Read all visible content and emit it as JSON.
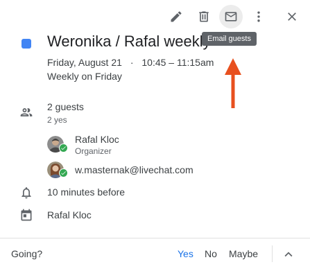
{
  "toolbar": {
    "tooltip": "Email guests",
    "icons": [
      "edit-icon",
      "delete-icon",
      "email-icon",
      "more-vert-icon",
      "close-icon"
    ]
  },
  "event": {
    "title": "Weronika / Rafal weekly",
    "date": "Friday, August 21",
    "separator": "·",
    "time": "10:45 – 11:15am",
    "recurrence": "Weekly on Friday",
    "color": "#4285f4"
  },
  "guests": {
    "count_label": "2 guests",
    "yes_label": "2 yes",
    "list": [
      {
        "name": "Rafal Kloc",
        "role": "Organizer"
      },
      {
        "name": "w.masternak@livechat.com",
        "role": ""
      }
    ]
  },
  "notification": {
    "label": "10 minutes before"
  },
  "calendar": {
    "owner": "Rafal Kloc"
  },
  "rsvp": {
    "question": "Going?",
    "options": [
      "Yes",
      "No",
      "Maybe"
    ],
    "selected": "Yes"
  },
  "colors": {
    "accent": "#1a73e8",
    "annotation_arrow": "#e8501f",
    "accepted": "#34a853"
  }
}
